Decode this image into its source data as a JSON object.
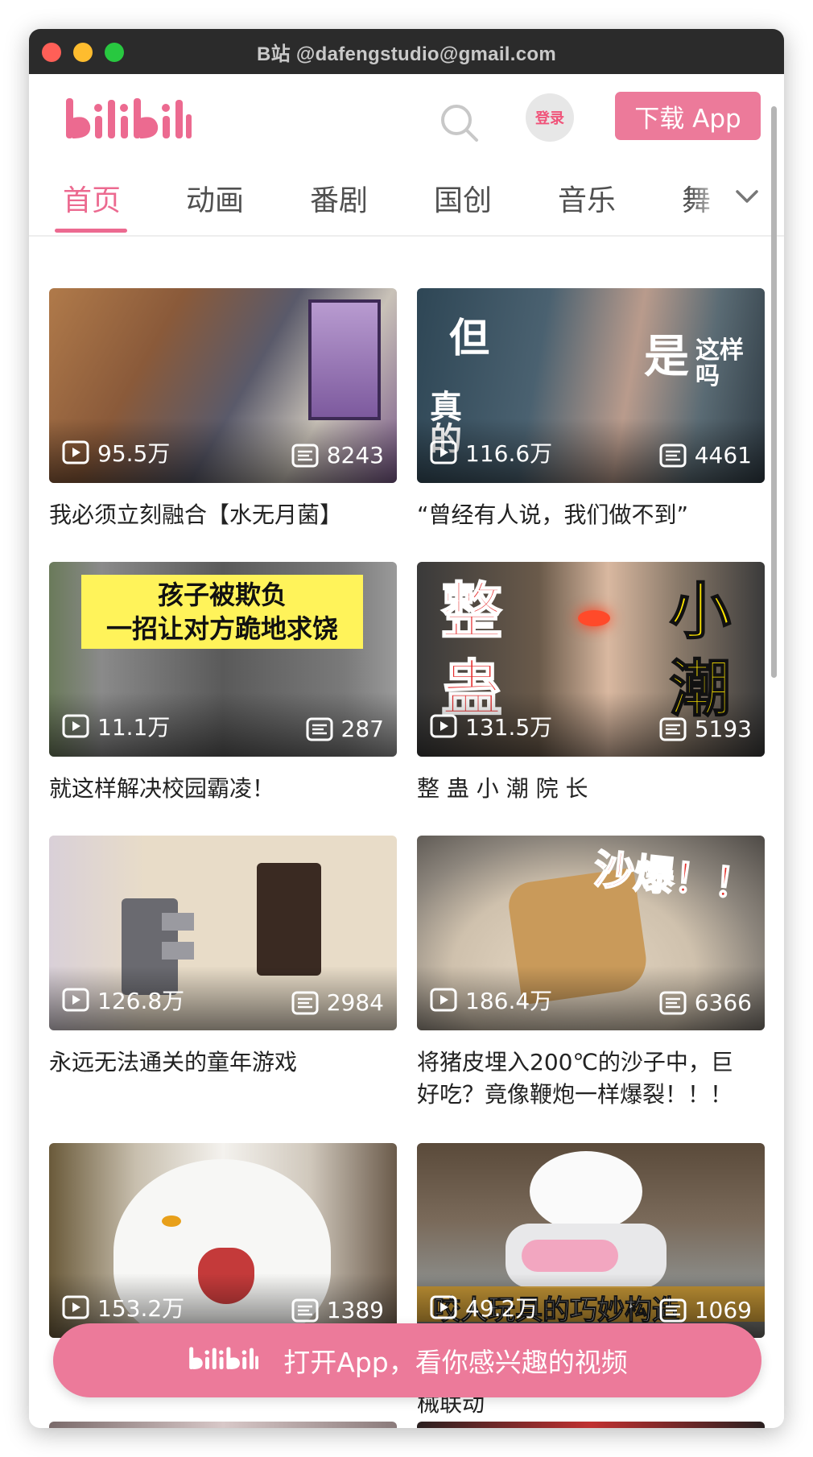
{
  "window": {
    "title": "B站 @dafengstudio@gmail.com"
  },
  "header": {
    "login_label": "登录",
    "download_label": "下载 App"
  },
  "tabs": [
    {
      "label": "首页"
    },
    {
      "label": "动画"
    },
    {
      "label": "番剧"
    },
    {
      "label": "国创"
    },
    {
      "label": "音乐"
    },
    {
      "label": "舞"
    }
  ],
  "videos": [
    {
      "title": "我必须立刻融合【水无月菌】",
      "views": "95.5万",
      "danmaku": "8243",
      "overlay": ""
    },
    {
      "title": "“曾经有人说，我们做不到”",
      "views": "116.6万",
      "danmaku": "4461",
      "overlay": "但 真的 是这样吗"
    },
    {
      "title": "就这样解决校园霸凌！",
      "views": "11.1万",
      "danmaku": "287",
      "overlay": "孩子被欺负 一招让对方跪地求饶"
    },
    {
      "title": "整 蛊 小 潮 院 长",
      "views": "131.5万",
      "danmaku": "5193",
      "overlay": "整蛊 小潮"
    },
    {
      "title": "永远无法通关的童年游戏",
      "views": "126.8万",
      "danmaku": "2984",
      "overlay": ""
    },
    {
      "title": "将猪皮埋入200℃的沙子中，巨好吃？竟像鞭炮一样爆裂！！！",
      "views": "186.4万",
      "danmaku": "6366",
      "overlay": "沙爆！！"
    },
    {
      "title": "",
      "views": "153.2万",
      "danmaku": "1389",
      "overlay": ""
    },
    {
      "title": "械联动",
      "views": "49.2万",
      "danmaku": "1069",
      "overlay": "咬人玩具的巧妙构造"
    }
  ],
  "open_app_banner": {
    "text": "打开App，看你感兴趣的视频"
  },
  "colors": {
    "brand_pink": "#ec7a9a",
    "active_tab": "#ec6a90"
  }
}
